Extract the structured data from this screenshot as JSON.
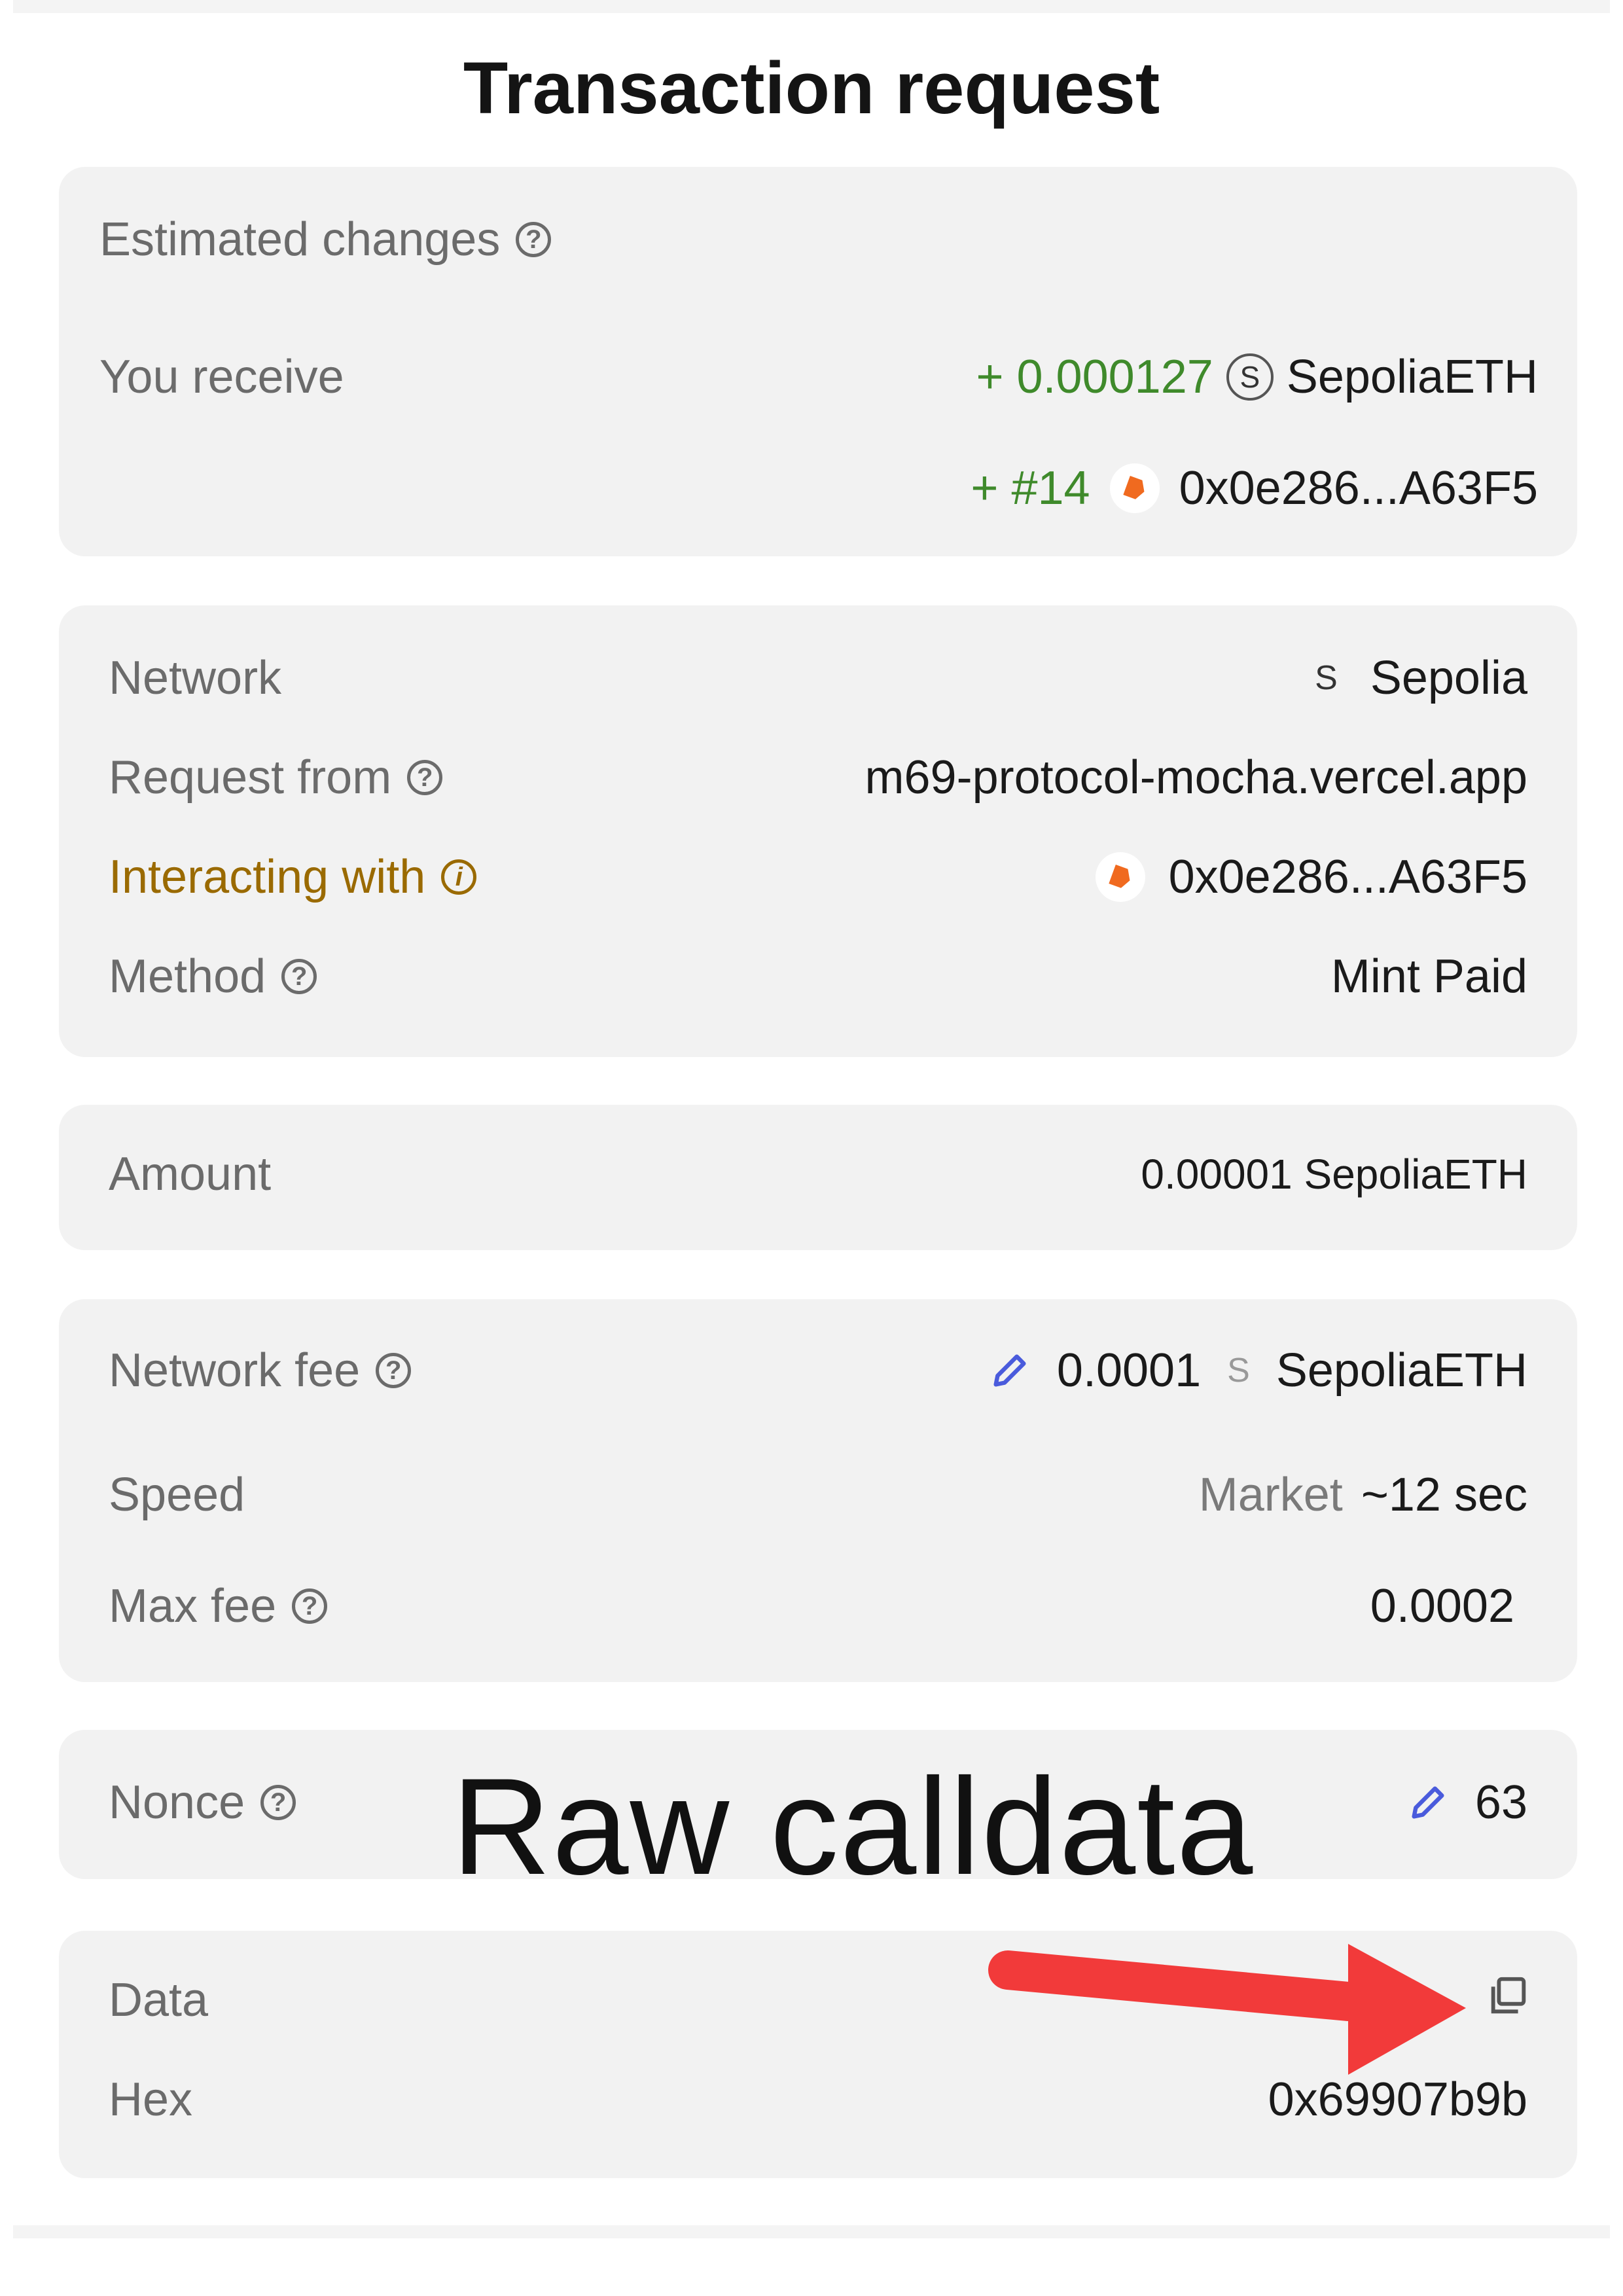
{
  "header": {
    "title": "Transaction request"
  },
  "estimated": {
    "heading": "Estimated changes",
    "receive_label": "You receive",
    "receive_amount": "+ 0.000127",
    "receive_symbol": "S",
    "receive_token": "SepoliaETH",
    "nft_id": "+ #14",
    "nft_address": "0x0e286...A63F5"
  },
  "details": {
    "network_label": "Network",
    "network_symbol": "S",
    "network_value": "Sepolia",
    "request_label": "Request from",
    "request_value": "m69-protocol-mocha.vercel.app",
    "interacting_label": "Interacting with",
    "interacting_value": "0x0e286...A63F5",
    "method_label": "Method",
    "method_value": "Mint Paid"
  },
  "amount": {
    "label": "Amount",
    "value": "0.00001 SepoliaETH"
  },
  "fees": {
    "network_fee_label": "Network fee",
    "network_fee_value": "0.0001",
    "network_fee_symbol": "S",
    "network_fee_token": "SepoliaETH",
    "speed_label": "Speed",
    "speed_mode": "Market",
    "speed_time": "~12 sec",
    "max_fee_label": "Max fee",
    "max_fee_value": "0.0002"
  },
  "nonce": {
    "label": "Nonce",
    "value": "63"
  },
  "data": {
    "label": "Data",
    "hex_label": "Hex",
    "hex_value": "0x69907b9b"
  },
  "annotation": {
    "text": "Raw calldata",
    "arrow_color": "#f23a3a"
  },
  "colors": {
    "accent_green": "#3f8a2b",
    "warning": "#9a6a00",
    "pencil": "#4a5bdc",
    "nft_orange": "#f06a1f"
  }
}
